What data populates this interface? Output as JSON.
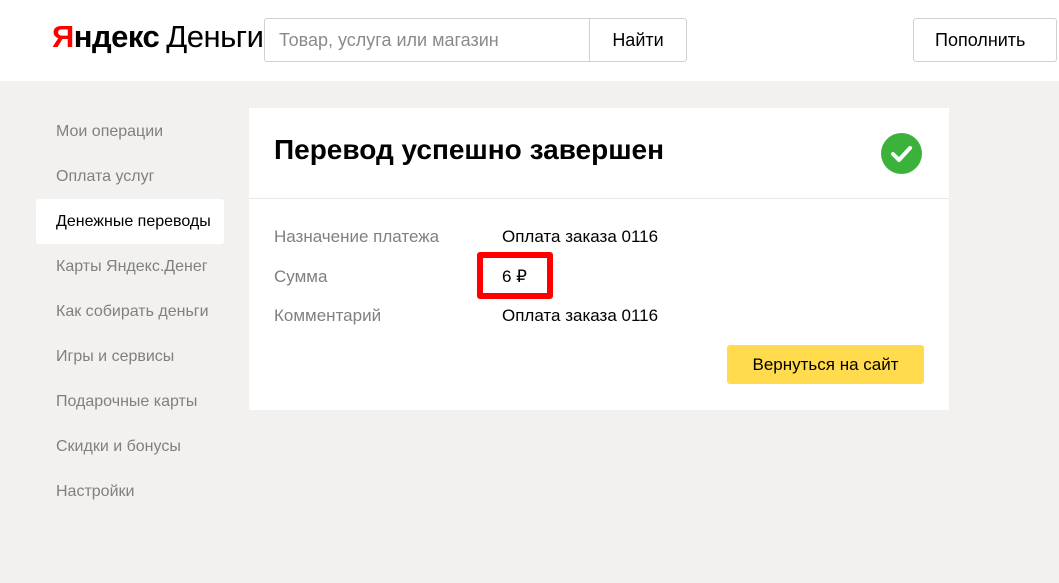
{
  "header": {
    "logo": {
      "ya_first": "Я",
      "ya_rest": "ндекс",
      "dengi": "Деньги"
    },
    "search": {
      "placeholder": "Товар, услуга или магазин",
      "value": "",
      "button_label": "Найти"
    },
    "topup_label": "Пополнить"
  },
  "sidebar": {
    "items": [
      {
        "label": "Мои операции",
        "active": false
      },
      {
        "label": "Оплата услуг",
        "active": false
      },
      {
        "label": "Денежные переводы",
        "active": true
      },
      {
        "label": "Карты Яндекс.Денег",
        "active": false
      },
      {
        "label": "Как собирать деньги",
        "active": false
      },
      {
        "label": "Игры и сервисы",
        "active": false
      },
      {
        "label": "Подарочные карты",
        "active": false
      },
      {
        "label": "Скидки и бонусы",
        "active": false
      },
      {
        "label": "Настройки",
        "active": false
      }
    ]
  },
  "transfer": {
    "title": "Перевод успешно завершен",
    "status_icon": "check-circle-icon",
    "details": [
      {
        "label": "Назначение платежа",
        "value": "Оплата заказа 0116"
      },
      {
        "label": "Сумма",
        "value": "6 ₽"
      },
      {
        "label": "Комментарий",
        "value": "Оплата заказа 0116"
      }
    ],
    "back_button_label": "Вернуться на сайт"
  },
  "colors": {
    "brand_red": "#ff0000",
    "accent_yellow": "#ffdb4d",
    "success_green": "#3bb33b",
    "page_bg": "#f2f1f0",
    "highlight_border": "#ff0000"
  }
}
